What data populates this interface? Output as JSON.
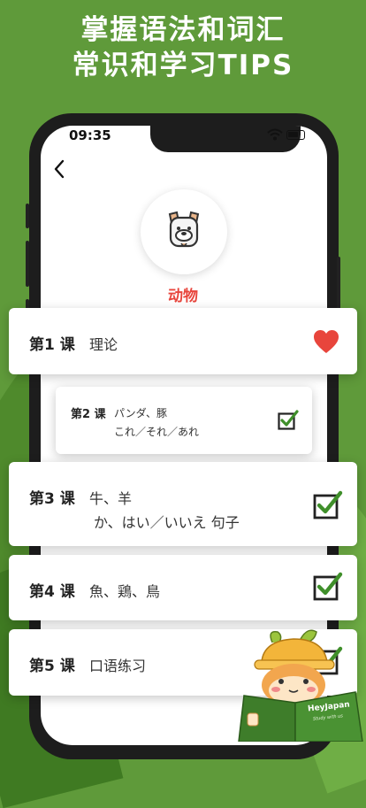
{
  "headline": {
    "line1": "掌握语法和词汇",
    "line2": "常识和学习TIPS"
  },
  "status_bar": {
    "time": "09:35"
  },
  "topic": {
    "name": "动物"
  },
  "lessons": [
    {
      "label": "第1 课",
      "line1": "理论",
      "line2": "",
      "marker": "heart",
      "favorite": true
    },
    {
      "label": "第2 课",
      "line1": "パンダ、豚",
      "line2": "これ／それ／あれ",
      "marker": "check",
      "completed": true
    },
    {
      "label": "第3 课",
      "line1": "牛、羊",
      "line2": "か、はい／いいえ 句子",
      "marker": "check",
      "completed": true
    },
    {
      "label": "第4 课",
      "line1": "魚、鶏、鳥",
      "line2": "",
      "marker": "check",
      "completed": true
    },
    {
      "label": "第5 课",
      "line1": "口语练习",
      "line2": "",
      "marker": "check",
      "completed": true
    }
  ],
  "mascot": {
    "book_text": "HeyJapan",
    "book_subtext": "Study with us"
  },
  "colors": {
    "background": "#5f9a3a",
    "accent_red": "#e8453c",
    "check_green": "#3f8f2a"
  },
  "icons": {
    "back": "chevron-left-icon",
    "topic": "dog-face-icon",
    "favorite": "heart-icon",
    "done": "checkbox-checked-icon"
  }
}
